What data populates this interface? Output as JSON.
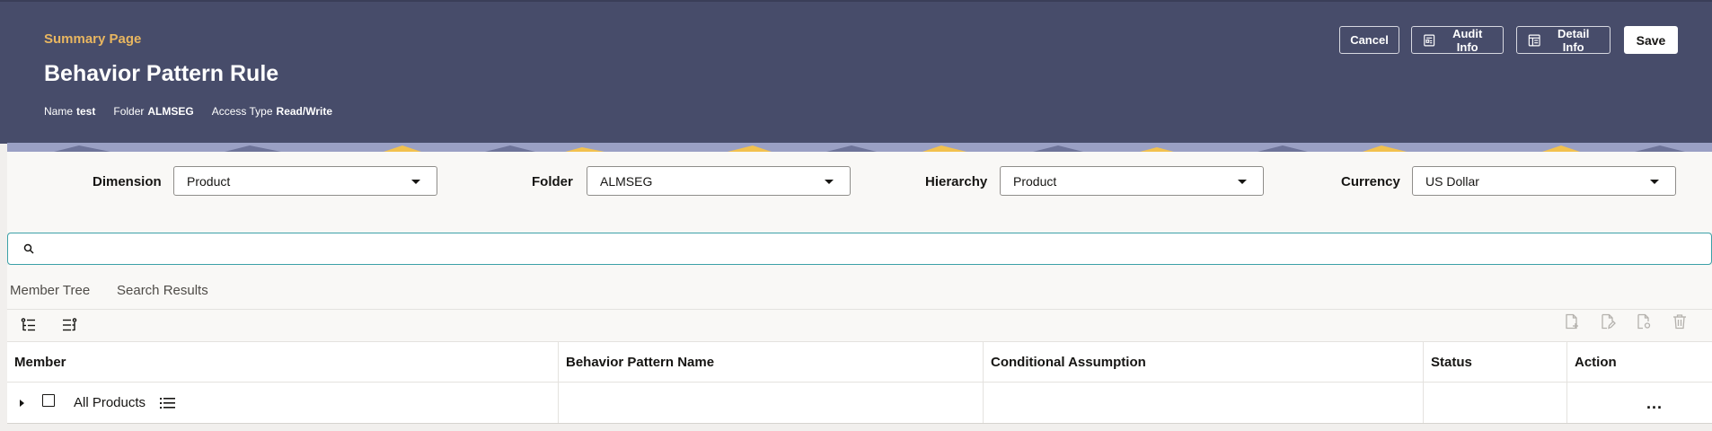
{
  "header": {
    "breadcrumb": "Summary Page",
    "title": "Behavior Pattern Rule",
    "meta": {
      "name_label": "Name",
      "name_value": "test",
      "folder_label": "Folder",
      "folder_value": "ALMSEG",
      "access_label": "Access Type",
      "access_value": "Read/Write"
    },
    "buttons": {
      "cancel": "Cancel",
      "audit": "Audit Info",
      "detail": "Detail Info",
      "save": "Save"
    }
  },
  "filters": {
    "dimension": {
      "label": "Dimension",
      "value": "Product"
    },
    "folder": {
      "label": "Folder",
      "value": "ALMSEG"
    },
    "hierarchy": {
      "label": "Hierarchy",
      "value": "Product"
    },
    "currency": {
      "label": "Currency",
      "value": "US Dollar"
    }
  },
  "search": {
    "placeholder": "",
    "value": ""
  },
  "tabs": [
    {
      "label": "Member Tree"
    },
    {
      "label": "Search Results"
    }
  ],
  "toolbar": {
    "left_icons": [
      "expand-all-icon",
      "collapse-all-icon"
    ],
    "right_icons": [
      "add-document-icon",
      "edit-document-icon",
      "view-document-icon",
      "delete-icon"
    ]
  },
  "table": {
    "columns": [
      "Member",
      "Behavior Pattern Name",
      "Conditional Assumption",
      "Status",
      "Action"
    ],
    "rows": [
      {
        "member": "All Products",
        "behavior_pattern_name": "",
        "conditional_assumption": "",
        "status": "",
        "action": "..."
      }
    ]
  },
  "colors": {
    "header_bg": "#474c6a",
    "breadcrumb": "#e8b660",
    "search_border": "#3ca1a8"
  }
}
